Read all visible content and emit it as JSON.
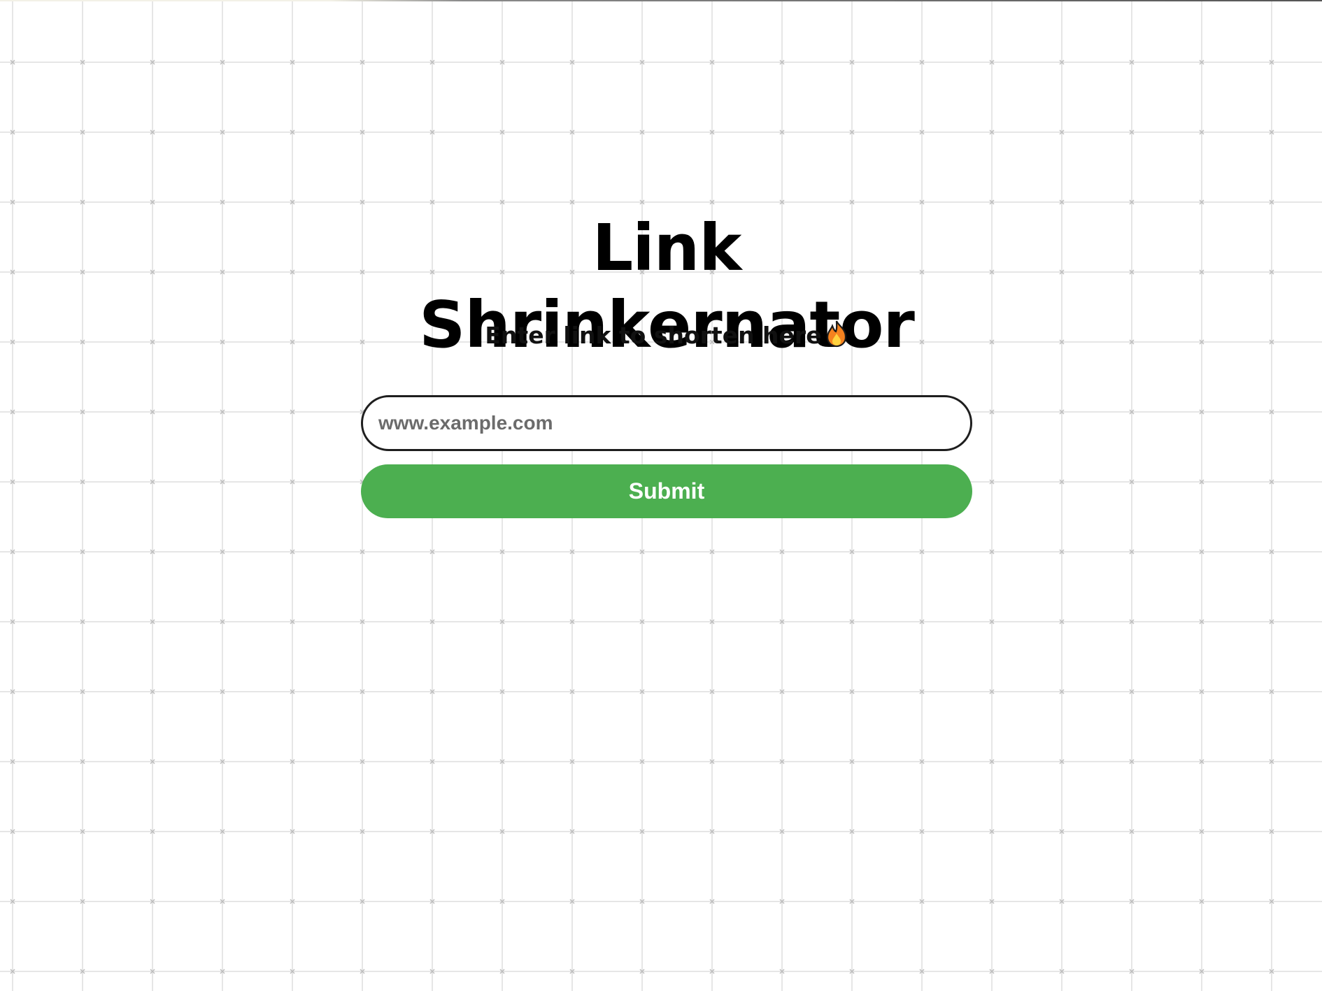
{
  "page": {
    "title": "Link Shrinkernator",
    "subtitle": "Enter link to shorten here",
    "subtitle_icon": "fire-icon"
  },
  "form": {
    "url_placeholder": "www.example.com",
    "url_value": "",
    "submit_label": "Submit"
  },
  "colors": {
    "background": "#ffffff",
    "grid_line": "#e6e6e6",
    "submit_button": "#4caf50",
    "submit_text": "#ffffff",
    "input_border": "#1e1e1e",
    "title_text": "#000000"
  }
}
